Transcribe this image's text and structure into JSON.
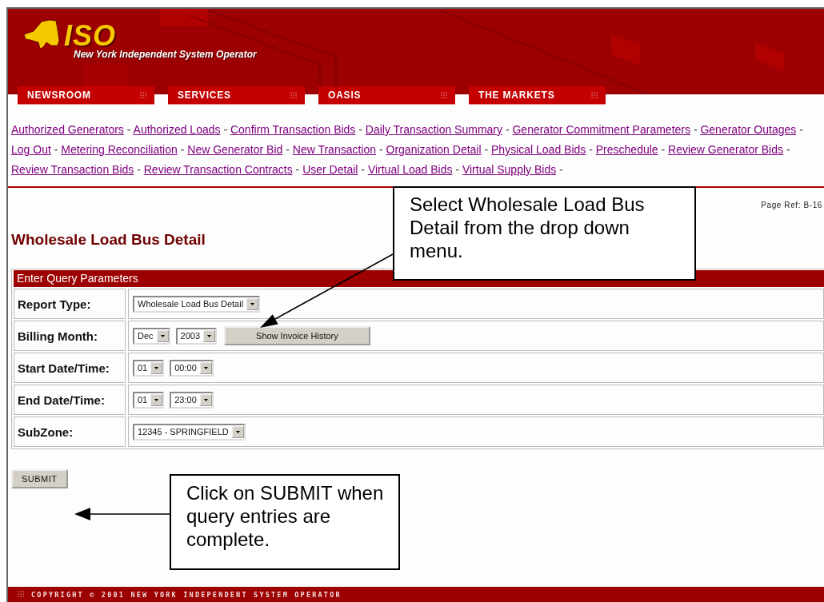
{
  "header": {
    "logo_text": "ISO",
    "subtitle": "New York Independent System Operator"
  },
  "nav_tabs": [
    {
      "label": "NEWSROOM"
    },
    {
      "label": "SERVICES"
    },
    {
      "label": "OASIS"
    },
    {
      "label": "THE MARKETS"
    }
  ],
  "links": [
    {
      "label": "Authorized Generators",
      "separator": "-"
    },
    {
      "label": "Authorized Loads",
      "separator": "-"
    },
    {
      "label": "Confirm Transaction Bids",
      "separator": "-"
    },
    {
      "label": "Daily Transaction Summary",
      "separator": "-"
    },
    {
      "label": "Generator Commitment Parameters",
      "separator": "-"
    },
    {
      "label": "Generator Outages",
      "separator": "-"
    },
    {
      "label": "Log Out",
      "separator": "-"
    },
    {
      "label": "Metering Reconciliation",
      "separator": "-"
    },
    {
      "label": "New Generator Bid",
      "separator": "-"
    },
    {
      "label": "New Transaction",
      "separator": "-"
    },
    {
      "label": "Organization Detail",
      "separator": "-"
    },
    {
      "label": "Physical Load Bids",
      "separator": "-"
    },
    {
      "label": "Preschedule",
      "separator": "-"
    },
    {
      "label": "Review Generator Bids",
      "separator": "-"
    },
    {
      "label": "Review Transaction Bids",
      "separator": "-"
    },
    {
      "label": "Review Transaction Contracts",
      "separator": "-"
    },
    {
      "label": "User Detail",
      "separator": "-"
    },
    {
      "label": "Virtual Load Bids",
      "separator": "-"
    },
    {
      "label": "Virtual Supply Bids",
      "separator": "-"
    }
  ],
  "page_ref": "Page Ref: B-16",
  "page_title": "Wholesale Load Bus Detail",
  "query_form": {
    "title": "Enter Query Parameters",
    "rows": [
      {
        "label": "Report Type:",
        "controls": [
          {
            "kind": "dropdown",
            "value": "Wholesale Load Bus Detail"
          }
        ]
      },
      {
        "label": "Billing Month:",
        "controls": [
          {
            "kind": "dropdown",
            "value": "Dec"
          },
          {
            "kind": "dropdown",
            "value": "2003"
          },
          {
            "kind": "button",
            "label": "Show Invoice History"
          }
        ]
      },
      {
        "label": "Start Date/Time:",
        "controls": [
          {
            "kind": "dropdown",
            "value": "01"
          },
          {
            "kind": "dropdown",
            "value": "00:00"
          }
        ]
      },
      {
        "label": "End Date/Time:",
        "controls": [
          {
            "kind": "dropdown",
            "value": "01"
          },
          {
            "kind": "dropdown",
            "value": "23:00"
          }
        ]
      },
      {
        "label": "SubZone:",
        "controls": [
          {
            "kind": "dropdown",
            "value": "12345 - SPRINGFIELD"
          }
        ]
      }
    ]
  },
  "submit_button": "SUBMIT",
  "callouts": [
    {
      "text": "Select Wholesale Load Bus Detail from the drop down menu."
    },
    {
      "text": "Click on SUBMIT when query entries are complete."
    }
  ],
  "footer": "COPYRIGHT © 2001 NEW YORK INDEPENDENT SYSTEM OPERATOR"
}
